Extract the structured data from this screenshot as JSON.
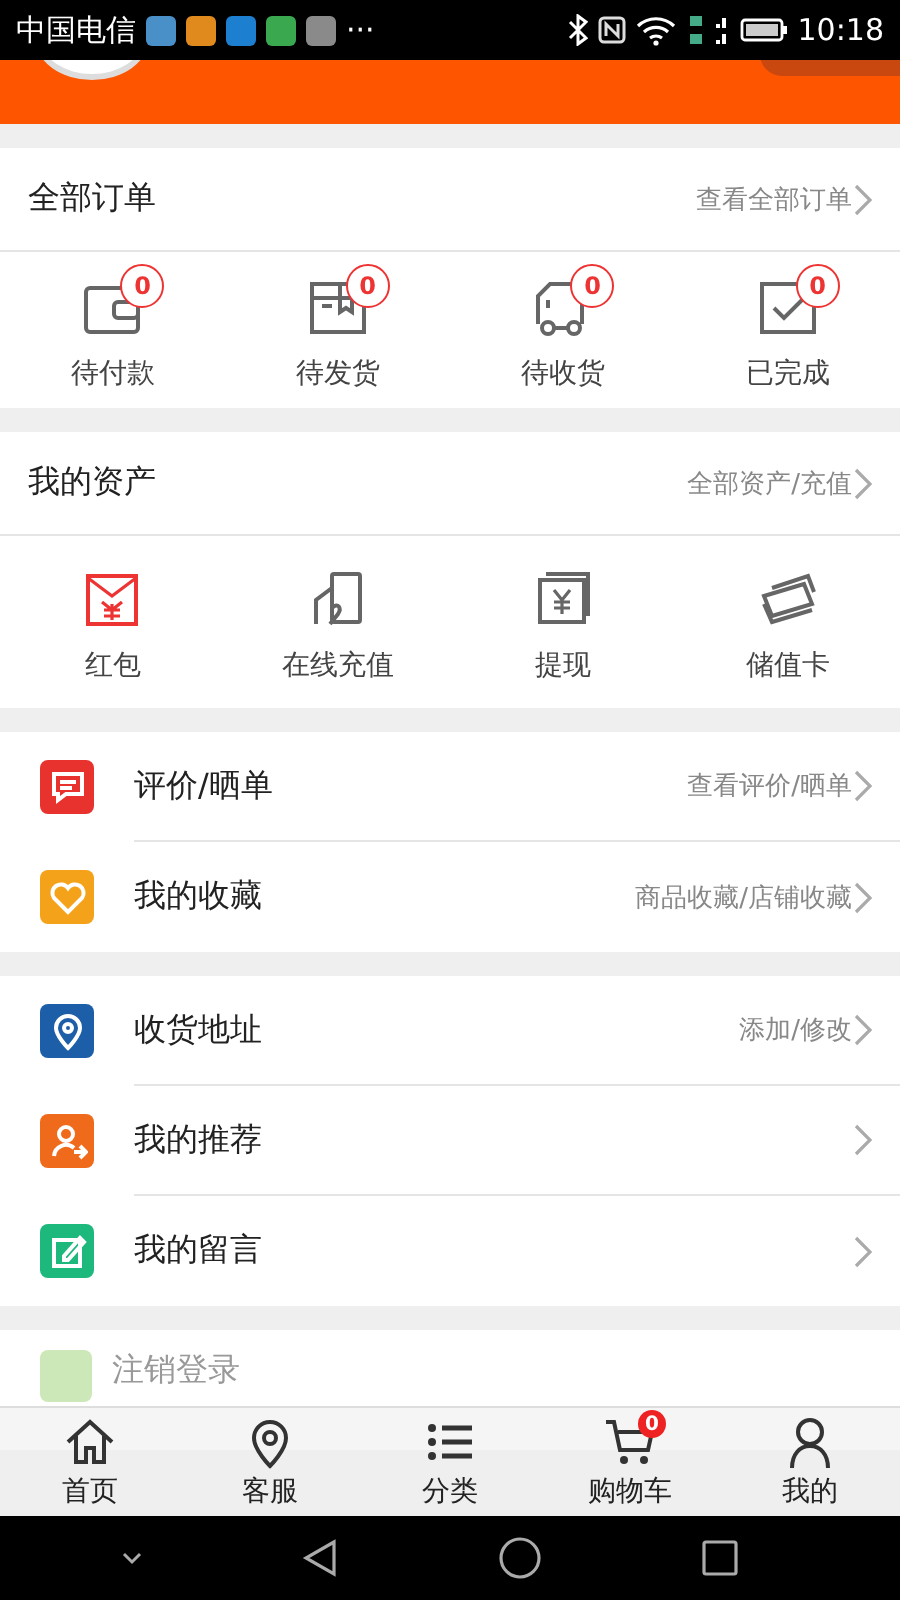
{
  "status_bar": {
    "carrier": "中国电信",
    "more": "···",
    "time": "10:18"
  },
  "orders": {
    "title": "全部订单",
    "link": "查看全部订单",
    "items": [
      {
        "label": "待付款",
        "count": "0"
      },
      {
        "label": "待发货",
        "count": "0"
      },
      {
        "label": "待收货",
        "count": "0"
      },
      {
        "label": "已完成",
        "count": "0"
      }
    ]
  },
  "assets": {
    "title": "我的资产",
    "link": "全部资产/充值",
    "items": [
      {
        "label": "红包"
      },
      {
        "label": "在线充值"
      },
      {
        "label": "提现"
      },
      {
        "label": "储值卡"
      }
    ]
  },
  "menu_groups": [
    [
      {
        "label": "评价/晒单",
        "link": "查看评价/晒单",
        "color": "#e8322d"
      },
      {
        "label": "我的收藏",
        "link": "商品收藏/店铺收藏",
        "color": "#f5a21b"
      }
    ],
    [
      {
        "label": "收货地址",
        "link": "添加/修改",
        "color": "#1d5ea8"
      },
      {
        "label": "我的推荐",
        "color": "#f06a1c"
      },
      {
        "label": "我的留言",
        "color": "#1db87c"
      }
    ]
  ],
  "logout": {
    "label": "注销登录"
  },
  "tab_bar": [
    {
      "label": "首页",
      "selected": false
    },
    {
      "label": "客服",
      "selected": false
    },
    {
      "label": "分类",
      "selected": false
    },
    {
      "label": "购物车",
      "badge": "0",
      "selected": false
    },
    {
      "label": "我的",
      "selected": false
    }
  ]
}
